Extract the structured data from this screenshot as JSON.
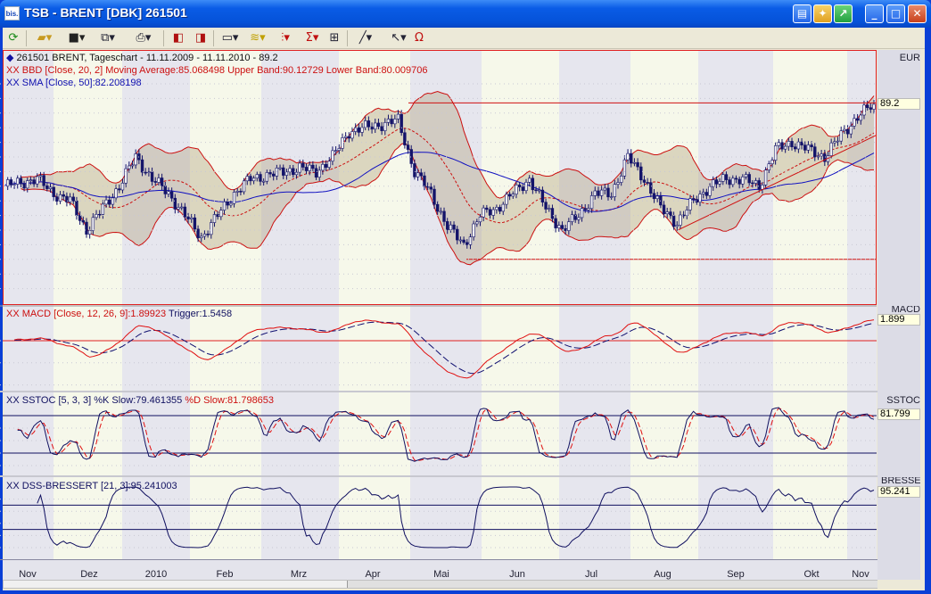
{
  "window": {
    "title": "TSB - BRENT [DBK] 261501",
    "app_icon": "bis.",
    "buttons": [
      "layout-icon",
      "palette-icon",
      "export-icon",
      "minimize-icon",
      "maximize-icon",
      "close-icon"
    ]
  },
  "toolbar": {
    "icons": [
      "refresh-icon",
      "open-folder-icon",
      "save-icon",
      "copy-icon",
      "print-icon",
      "chart-back-icon",
      "chart-forward-icon",
      "window-icon",
      "indicator-icon",
      "chart-type-icon",
      "sigma-icon",
      "properties-icon",
      "draw-line-icon",
      "pointer-icon",
      "magnet-icon"
    ]
  },
  "main": {
    "legend_symbol": "261501  BRENT, Tageschart - 11.11.2009 - 11.11.2010 - 89.2",
    "legend_bbd": "XX BBD [Close, 20, 2] Moving Average:85.068498 Upper Band:90.12729 Lower Band:80.009706",
    "legend_sma": "XX SMA [Close, 50]:82.208198",
    "currency": "EUR",
    "last_value": "89.2"
  },
  "macd": {
    "legend_main": "XX MACD [Close, 12, 26, 9]:1.89923",
    "legend_trigger": "Trigger:1.5458",
    "name": "MACD",
    "last_value": "1.899"
  },
  "sstoc": {
    "legend_k": "XX SSTOC [5, 3, 3] %K Slow:79.461355",
    "legend_d": "%D Slow:81.798653",
    "name": "SSTOC",
    "last_value": "81.799"
  },
  "dss": {
    "legend": "XX DSS-BRESSERT [21, 3]:95.241003",
    "name": "BRESSERT",
    "last_value": "95.241"
  },
  "colors": {
    "up_candle": "#f4f4f4",
    "down_candle": "#14146a",
    "band": "#cc1010",
    "band_fill": "#a89870",
    "sma": "#1010c0",
    "month_a": "#e6e6ee",
    "month_b": "#f6f8ea"
  },
  "chart_data": [
    {
      "type": "candlestick",
      "title": "261501 BRENT, Tageschart",
      "x_range": [
        "11.11.2009",
        "11.11.2010"
      ],
      "weekly_close": [
        78,
        78.5,
        79,
        77,
        76,
        72,
        75,
        78,
        82,
        79,
        77,
        74,
        71,
        74,
        77,
        79,
        79.5,
        80,
        80.5,
        80,
        82,
        85.5,
        86,
        86.5,
        87,
        80,
        77,
        72.5,
        70,
        74,
        75,
        77,
        79,
        75,
        72,
        74,
        77,
        77,
        82,
        79,
        75,
        73,
        76,
        78,
        79,
        79,
        78,
        83,
        84,
        83,
        82,
        85,
        87.5,
        89.2
      ],
      "ylim": [
        62,
        94
      ],
      "yticks": [
        64,
        66,
        68,
        70,
        72,
        74,
        76,
        78,
        80,
        82,
        84,
        86,
        88,
        90,
        92
      ],
      "indicators": [
        {
          "name": "BBD",
          "period": 20,
          "k": 2
        },
        {
          "name": "SMA",
          "period": 50
        }
      ],
      "horizontal_lines": [
        89.4,
        68
      ],
      "trendline": [
        72,
        85
      ]
    },
    {
      "type": "line",
      "title": "MACD",
      "params": [
        12,
        26,
        9
      ],
      "ylim": [
        -5,
        3
      ],
      "yticks": [
        -4,
        -2,
        0
      ],
      "reference_line": 0
    },
    {
      "type": "line",
      "title": "SSTOC",
      "params": [
        5,
        3,
        3
      ],
      "ylim": [
        -5,
        100
      ],
      "yticks": [
        0,
        20,
        40,
        60
      ],
      "reference_lines": [
        20,
        80
      ]
    },
    {
      "type": "line",
      "title": "DSS-BRESSERT",
      "params": [
        21,
        3
      ],
      "ylim": [
        -20,
        100
      ],
      "yticks": [
        0,
        20,
        40,
        60,
        80
      ],
      "reference_lines": [
        30,
        70
      ]
    }
  ],
  "x_axis": {
    "months": [
      "Nov",
      "Dez",
      "2010",
      "Feb",
      "Mrz",
      "Apr",
      "Mai",
      "Jun",
      "Jul",
      "Aug",
      "Sep",
      "Okt",
      "Nov"
    ]
  }
}
